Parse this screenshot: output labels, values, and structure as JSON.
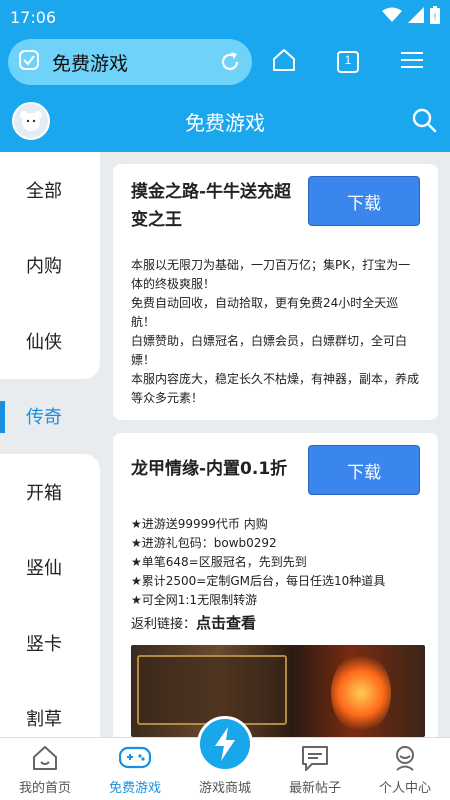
{
  "status_bar": {
    "time": "17:06"
  },
  "browser": {
    "url_title": "免费游戏",
    "tab_count": "1"
  },
  "header": {
    "title": "免费游戏"
  },
  "sidebar": {
    "items": [
      {
        "label": "全部"
      },
      {
        "label": "内购"
      },
      {
        "label": "仙侠"
      },
      {
        "label": "传奇",
        "active": true
      },
      {
        "label": "开箱"
      },
      {
        "label": "竖仙"
      },
      {
        "label": "竖卡"
      },
      {
        "label": "割草"
      }
    ]
  },
  "games": [
    {
      "title": "摸金之路-牛牛送充超变之王",
      "download_label": "下载",
      "description": [
        "本服以无限刀为基础，一刀百万亿；集PK，打宝为一体的终极爽服！",
        "免费自动回收，自动拾取，更有免费24小时全天巡航！",
        "白嫖赞助，白嫖冠名，白嫖会员，白嫖群切，全可白嫖！",
        "本服内容庞大，稳定长久不枯燥，有神器，副本，养成等众多元素！"
      ]
    },
    {
      "title": "龙甲情缘-内置0.1折",
      "download_label": "下载",
      "description": [
        "★进游送99999代币 内购",
        "★进游礼包码：bowb0292",
        "★单笔648=区服冠名，先到先到",
        "★累计2500=定制GM后台，每日任选10种道具",
        "★可全网1:1无限制转游"
      ],
      "rebate_label": "返利链接：",
      "rebate_link": "点击查看"
    }
  ],
  "bottom_nav": {
    "items": [
      {
        "label": "我的首页"
      },
      {
        "label": "免费游戏",
        "active": true
      },
      {
        "label": "游戏商城"
      },
      {
        "label": "最新帖子"
      },
      {
        "label": "个人中心"
      }
    ]
  },
  "colors": {
    "primary": "#1aa7ee",
    "accent": "#1a8fe0",
    "button": "#3a86ec"
  }
}
